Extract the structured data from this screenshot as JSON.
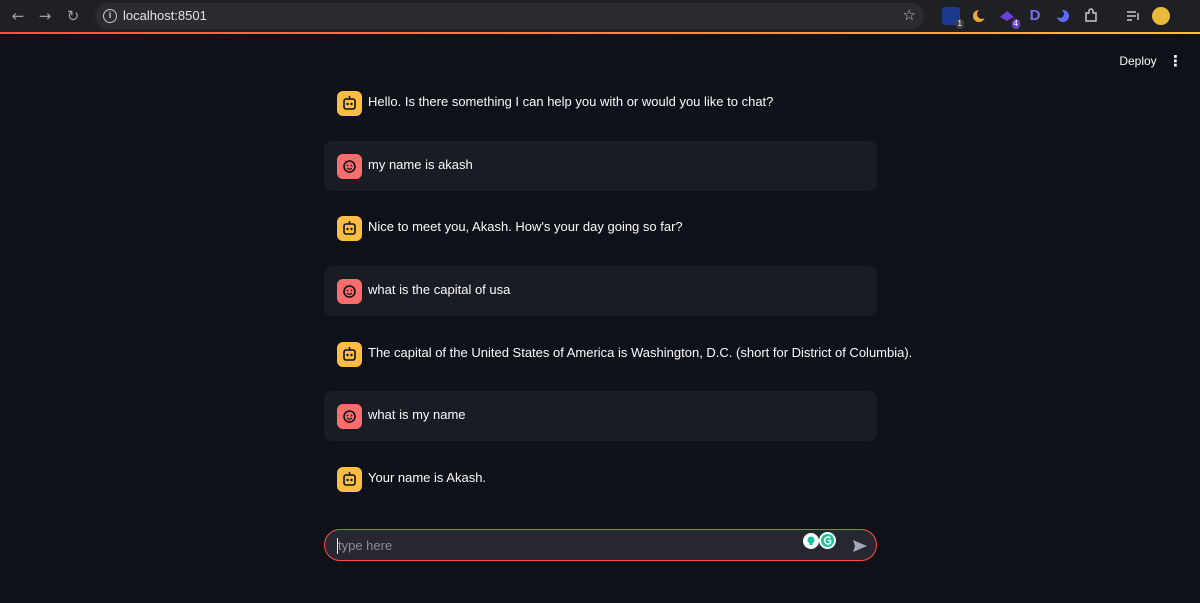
{
  "browser": {
    "url": "localhost:8501",
    "extension_badges": [
      "1",
      "4"
    ],
    "extension_letter": "D"
  },
  "header": {
    "deploy_label": "Deploy"
  },
  "messages": [
    {
      "role": "assistant",
      "text": "Hello. Is there something I can help you with or would you like to chat?"
    },
    {
      "role": "user",
      "text": "my name is akash"
    },
    {
      "role": "assistant",
      "text": "Nice to meet you, Akash. How's your day going so far?"
    },
    {
      "role": "user",
      "text": "what is the capital of usa"
    },
    {
      "role": "assistant",
      "text": "The capital of the United States of America is Washington, D.C. (short for District of Columbia)."
    },
    {
      "role": "user",
      "text": "what is my name"
    },
    {
      "role": "assistant",
      "text": "Your name is Akash."
    }
  ],
  "chat_input": {
    "placeholder": "type here"
  },
  "colors": {
    "background": "#0e1117",
    "user_bubble": "#1a1c24",
    "assistant_avatar": "#ffbd45",
    "user_avatar": "#ff6c6c",
    "accent": "#ff4b4b"
  },
  "icons": {
    "assistant_avatar": "robot-face-icon",
    "user_avatar": "smiley-face-icon",
    "send": "send-arrow-icon"
  }
}
